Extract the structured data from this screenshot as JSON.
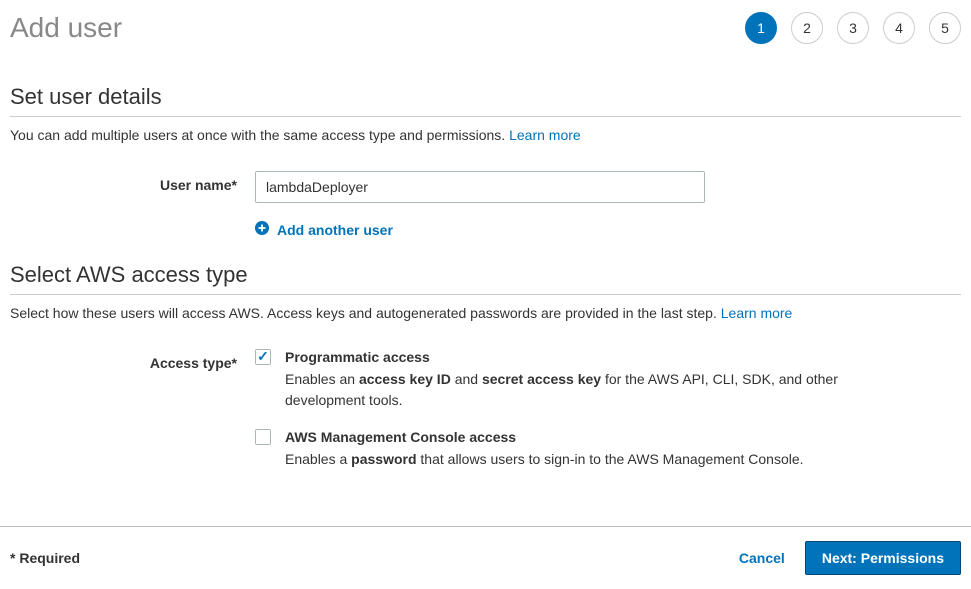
{
  "page_title": "Add user",
  "steps": [
    "1",
    "2",
    "3",
    "4",
    "5"
  ],
  "current_step": 1,
  "section_details": {
    "title": "Set user details",
    "desc": "You can add multiple users at once with the same access type and permissions.",
    "learn_more": "Learn more"
  },
  "form": {
    "username_label": "User name*",
    "username_value": "lambdaDeployer",
    "add_another": "Add another user"
  },
  "section_access": {
    "title": "Select AWS access type",
    "desc": "Select how these users will access AWS. Access keys and autogenerated passwords are provided in the last step.",
    "learn_more": "Learn more"
  },
  "access_label": "Access type*",
  "access_options": {
    "programmatic": {
      "title": "Programmatic access",
      "desc_pre": "Enables an ",
      "desc_b1": "access key ID",
      "desc_mid": " and ",
      "desc_b2": "secret access key",
      "desc_post": " for the AWS API, CLI, SDK, and other development tools.",
      "checked": true
    },
    "console": {
      "title": "AWS Management Console access",
      "desc_pre": "Enables a ",
      "desc_b1": "password",
      "desc_post": " that allows users to sign-in to the AWS Management Console.",
      "checked": false
    }
  },
  "footer": {
    "required": "* Required",
    "cancel": "Cancel",
    "next": "Next: Permissions"
  }
}
